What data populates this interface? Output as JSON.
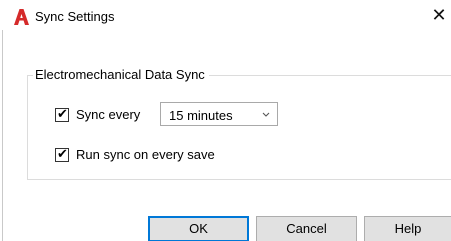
{
  "window": {
    "title": "Sync Settings",
    "close_glyph": "✕",
    "app_icon": "autocad-a-icon",
    "accent_color": "#d52a2a"
  },
  "group": {
    "legend": "Electromechanical Data Sync",
    "sync_every": {
      "checked": true,
      "label": "Sync every",
      "interval": {
        "selected": "15 minutes"
      }
    },
    "run_on_save": {
      "checked": true,
      "label": "Run sync on every save"
    }
  },
  "buttons": {
    "ok": "OK",
    "cancel": "Cancel",
    "help": "Help"
  }
}
